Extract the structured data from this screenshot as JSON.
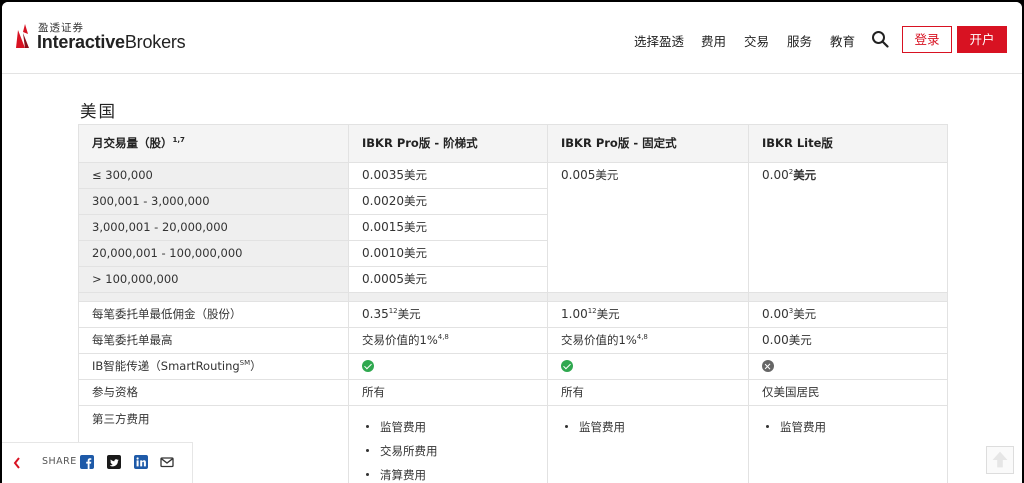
{
  "header": {
    "logo_cn": "盈透证券",
    "logo_en_bold": "Interactive",
    "logo_en_light": "Brokers",
    "nav": [
      "选择盈透",
      "费用",
      "交易",
      "服务",
      "教育"
    ],
    "login": "登录",
    "open": "开户"
  },
  "section_title": "美国",
  "table": {
    "headers": {
      "col1": "月交易量（股）",
      "col1_sup": "1,7",
      "col2": "IBKR Pro版 - 阶梯式",
      "col3": "IBKR Pro版 - 固定式",
      "col4": "IBKR Lite版"
    },
    "tiers": [
      {
        "volume": "≤ 300,000",
        "price": "0.0035",
        "unit": "美元"
      },
      {
        "volume": "300,001 - 3,000,000",
        "price": "0.0020",
        "unit": "美元"
      },
      {
        "volume": "3,000,001 - 20,000,000",
        "price": "0.0015",
        "unit": "美元"
      },
      {
        "volume": "20,000,001 - 100,000,000",
        "price": "0.0010",
        "unit": "美元"
      },
      {
        "volume": "> 100,000,000",
        "price": "0.0005",
        "unit": "美元"
      }
    ],
    "fixed_price": "0.005",
    "fixed_unit": "美元",
    "lite_price": "0.00",
    "lite_sup": "2",
    "lite_unit": "美元",
    "min_row": {
      "label": "每笔委托单最低佣金（股份）",
      "tiered": "0.35",
      "tiered_sup": "12",
      "tiered_unit": "美元",
      "fixed": "1.00",
      "fixed_sup": "12",
      "fixed_unit": "美元",
      "lite": "0.00",
      "lite_sup": "3",
      "lite_unit": "美元"
    },
    "max_row": {
      "label": "每笔委托单最高",
      "tiered": "交易价值的1%",
      "tiered_sup": "4,8",
      "fixed": "交易价值的1%",
      "fixed_sup": "4,8",
      "lite": "0.00",
      "lite_unit": "美元"
    },
    "routing_row": {
      "label_pre": "IB智能传递（SmartRouting",
      "label_sup": "SM",
      "label_post": "）",
      "tiered": "check",
      "fixed": "check",
      "lite": "cross"
    },
    "eligibility_row": {
      "label": "参与资格",
      "tiered": "所有",
      "fixed": "所有",
      "lite": "仅美国居民"
    },
    "third_party_row": {
      "label": "第三方费用",
      "tiered": [
        "监管费用",
        "交易所费用",
        "清算费用"
      ],
      "fixed": [
        "监管费用"
      ],
      "lite": [
        "监管费用"
      ]
    }
  },
  "share": {
    "label": "SHARE",
    "icons": [
      "facebook-icon",
      "twitter-icon",
      "linkedin-icon",
      "email-icon"
    ]
  },
  "colors": {
    "brand_red": "#d81222",
    "check_green": "#2fa84f",
    "header_bg": "#f4f4f4"
  }
}
